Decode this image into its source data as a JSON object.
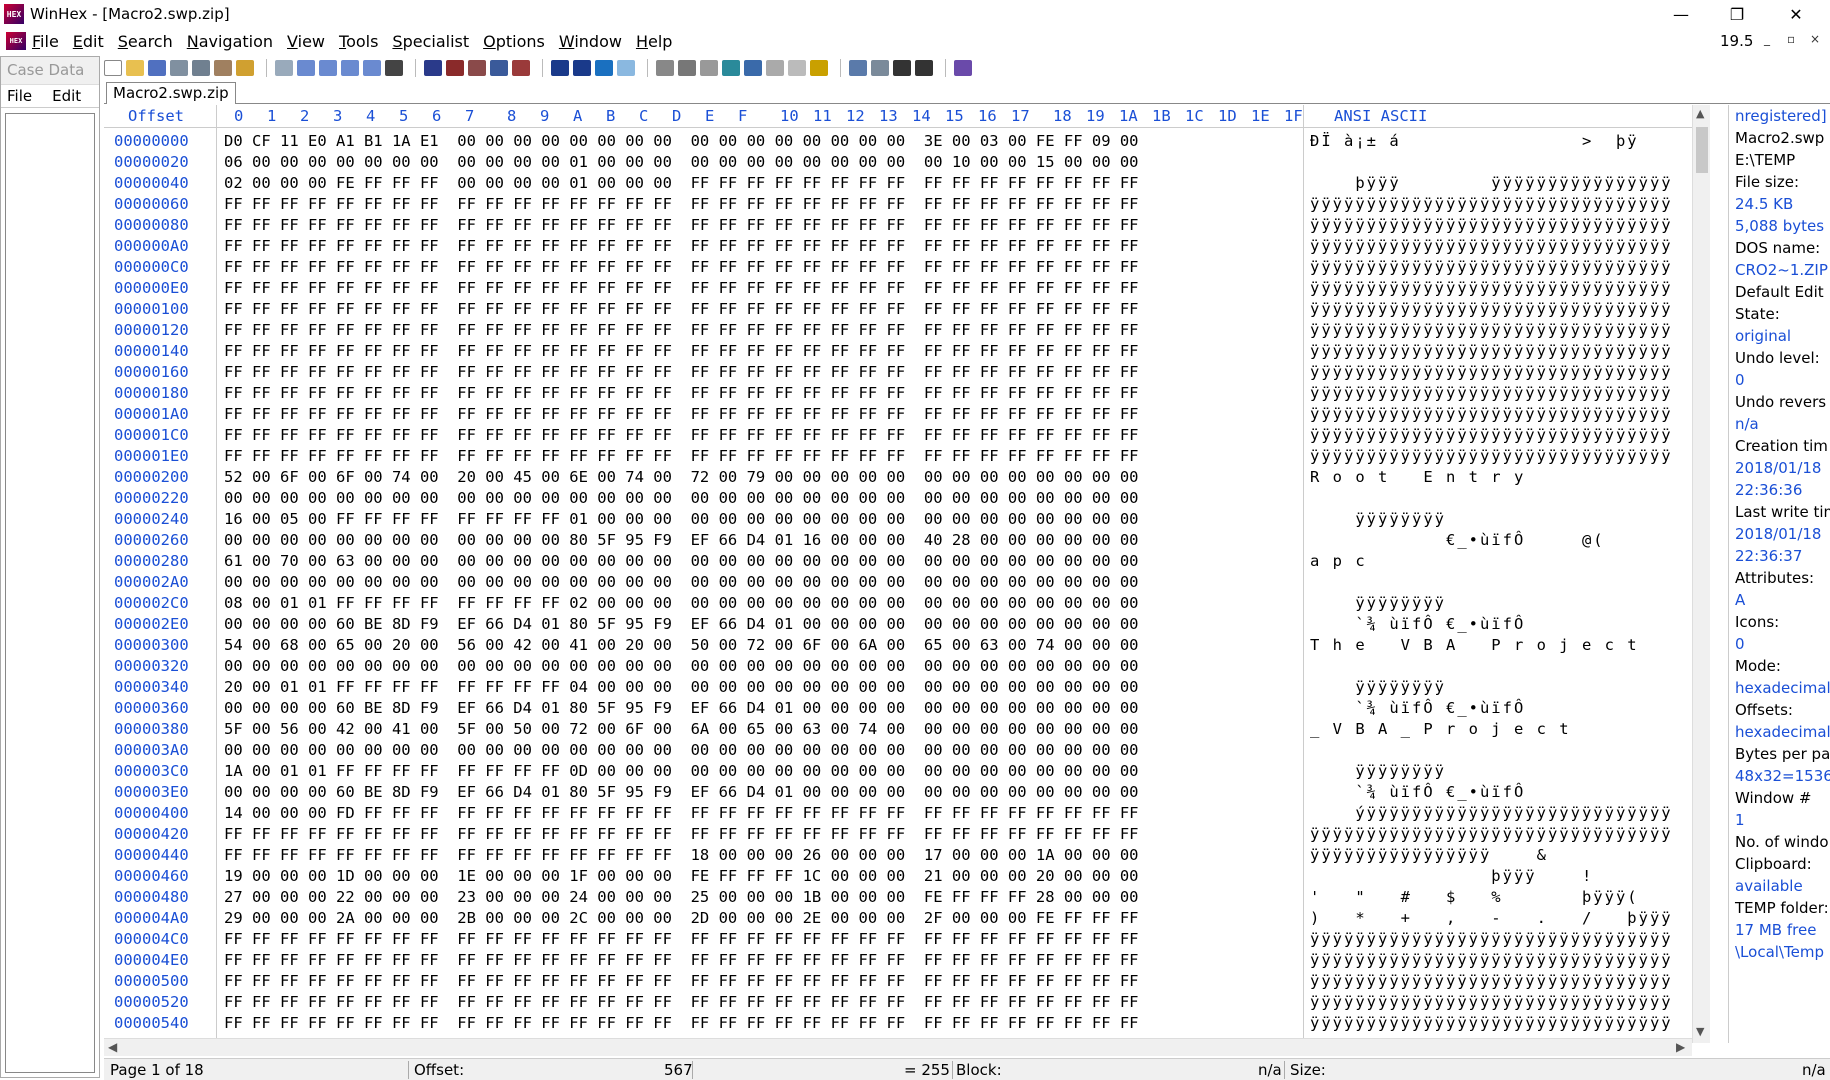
{
  "window": {
    "title": "WinHex - [Macro2.swp.zip]",
    "app_icon": "HEX",
    "min_glyph": "—",
    "max_glyph": "❐",
    "close_glyph": "✕"
  },
  "menu": {
    "items": [
      "File",
      "Edit",
      "Search",
      "Navigation",
      "View",
      "Tools",
      "Specialist",
      "Options",
      "Window",
      "Help"
    ],
    "zoom": "19.5",
    "mdi_min": "_",
    "mdi_restore": "▫",
    "mdi_close": "×"
  },
  "left_pane": {
    "title": "Case Data",
    "menu": [
      "File",
      "Edit"
    ]
  },
  "tab": {
    "label": "Macro2.swp.zip"
  },
  "hex": {
    "offset_header": "Offset",
    "column_headers": [
      "0",
      "1",
      "2",
      "3",
      "4",
      "5",
      "6",
      "7",
      "8",
      "9",
      "A",
      "B",
      "C",
      "D",
      "E",
      "F",
      "10",
      "11",
      "12",
      "13",
      "14",
      "15",
      "16",
      "17",
      "18",
      "19",
      "1A",
      "1B",
      "1C",
      "1D",
      "1E",
      "1F"
    ],
    "text_header": "ANSI ASCII",
    "rows": [
      {
        "offset": "00000000",
        "hex": "D0 CF 11 E0 A1 B1 1A E1  00 00 00 00 00 00 00 00  00 00 00 00 00 00 00 00  3E 00 03 00 FE FF 09 00",
        "ascii": "ÐÏ à¡± á                >  þÿ"
      },
      {
        "offset": "00000020",
        "hex": "06 00 00 00 00 00 00 00  00 00 00 00 01 00 00 00  00 00 00 00 00 00 00 00  00 10 00 00 15 00 00 00",
        "ascii": ""
      },
      {
        "offset": "00000040",
        "hex": "02 00 00 00 FE FF FF FF  00 00 00 00 01 00 00 00  FF FF FF FF FF FF FF FF  FF FF FF FF FF FF FF FF",
        "ascii": "    þÿÿÿ        ÿÿÿÿÿÿÿÿÿÿÿÿÿÿÿÿ"
      },
      {
        "offset": "00000060",
        "hex": "FF FF FF FF FF FF FF FF  FF FF FF FF FF FF FF FF  FF FF FF FF FF FF FF FF  FF FF FF FF FF FF FF FF",
        "ascii": "ÿÿÿÿÿÿÿÿÿÿÿÿÿÿÿÿÿÿÿÿÿÿÿÿÿÿÿÿÿÿÿÿ"
      },
      {
        "offset": "00000080",
        "hex": "FF FF FF FF FF FF FF FF  FF FF FF FF FF FF FF FF  FF FF FF FF FF FF FF FF  FF FF FF FF FF FF FF FF",
        "ascii": "ÿÿÿÿÿÿÿÿÿÿÿÿÿÿÿÿÿÿÿÿÿÿÿÿÿÿÿÿÿÿÿÿ"
      },
      {
        "offset": "000000A0",
        "hex": "FF FF FF FF FF FF FF FF  FF FF FF FF FF FF FF FF  FF FF FF FF FF FF FF FF  FF FF FF FF FF FF FF FF",
        "ascii": "ÿÿÿÿÿÿÿÿÿÿÿÿÿÿÿÿÿÿÿÿÿÿÿÿÿÿÿÿÿÿÿÿ"
      },
      {
        "offset": "000000C0",
        "hex": "FF FF FF FF FF FF FF FF  FF FF FF FF FF FF FF FF  FF FF FF FF FF FF FF FF  FF FF FF FF FF FF FF FF",
        "ascii": "ÿÿÿÿÿÿÿÿÿÿÿÿÿÿÿÿÿÿÿÿÿÿÿÿÿÿÿÿÿÿÿÿ"
      },
      {
        "offset": "000000E0",
        "hex": "FF FF FF FF FF FF FF FF  FF FF FF FF FF FF FF FF  FF FF FF FF FF FF FF FF  FF FF FF FF FF FF FF FF",
        "ascii": "ÿÿÿÿÿÿÿÿÿÿÿÿÿÿÿÿÿÿÿÿÿÿÿÿÿÿÿÿÿÿÿÿ"
      },
      {
        "offset": "00000100",
        "hex": "FF FF FF FF FF FF FF FF  FF FF FF FF FF FF FF FF  FF FF FF FF FF FF FF FF  FF FF FF FF FF FF FF FF",
        "ascii": "ÿÿÿÿÿÿÿÿÿÿÿÿÿÿÿÿÿÿÿÿÿÿÿÿÿÿÿÿÿÿÿÿ"
      },
      {
        "offset": "00000120",
        "hex": "FF FF FF FF FF FF FF FF  FF FF FF FF FF FF FF FF  FF FF FF FF FF FF FF FF  FF FF FF FF FF FF FF FF",
        "ascii": "ÿÿÿÿÿÿÿÿÿÿÿÿÿÿÿÿÿÿÿÿÿÿÿÿÿÿÿÿÿÿÿÿ"
      },
      {
        "offset": "00000140",
        "hex": "FF FF FF FF FF FF FF FF  FF FF FF FF FF FF FF FF  FF FF FF FF FF FF FF FF  FF FF FF FF FF FF FF FF",
        "ascii": "ÿÿÿÿÿÿÿÿÿÿÿÿÿÿÿÿÿÿÿÿÿÿÿÿÿÿÿÿÿÿÿÿ"
      },
      {
        "offset": "00000160",
        "hex": "FF FF FF FF FF FF FF FF  FF FF FF FF FF FF FF FF  FF FF FF FF FF FF FF FF  FF FF FF FF FF FF FF FF",
        "ascii": "ÿÿÿÿÿÿÿÿÿÿÿÿÿÿÿÿÿÿÿÿÿÿÿÿÿÿÿÿÿÿÿÿ"
      },
      {
        "offset": "00000180",
        "hex": "FF FF FF FF FF FF FF FF  FF FF FF FF FF FF FF FF  FF FF FF FF FF FF FF FF  FF FF FF FF FF FF FF FF",
        "ascii": "ÿÿÿÿÿÿÿÿÿÿÿÿÿÿÿÿÿÿÿÿÿÿÿÿÿÿÿÿÿÿÿÿ"
      },
      {
        "offset": "000001A0",
        "hex": "FF FF FF FF FF FF FF FF  FF FF FF FF FF FF FF FF  FF FF FF FF FF FF FF FF  FF FF FF FF FF FF FF FF",
        "ascii": "ÿÿÿÿÿÿÿÿÿÿÿÿÿÿÿÿÿÿÿÿÿÿÿÿÿÿÿÿÿÿÿÿ"
      },
      {
        "offset": "000001C0",
        "hex": "FF FF FF FF FF FF FF FF  FF FF FF FF FF FF FF FF  FF FF FF FF FF FF FF FF  FF FF FF FF FF FF FF FF",
        "ascii": "ÿÿÿÿÿÿÿÿÿÿÿÿÿÿÿÿÿÿÿÿÿÿÿÿÿÿÿÿÿÿÿÿ"
      },
      {
        "offset": "000001E0",
        "hex": "FF FF FF FF FF FF FF FF  FF FF FF FF FF FF FF FF  FF FF FF FF FF FF FF FF  FF FF FF FF FF FF FF FF",
        "ascii": "ÿÿÿÿÿÿÿÿÿÿÿÿÿÿÿÿÿÿÿÿÿÿÿÿÿÿÿÿÿÿÿÿ"
      },
      {
        "offset": "00000200",
        "hex": "52 00 6F 00 6F 00 74 00  20 00 45 00 6E 00 74 00  72 00 79 00 00 00 00 00  00 00 00 00 00 00 00 00",
        "ascii": "R o o t   E n t r y"
      },
      {
        "offset": "00000220",
        "hex": "00 00 00 00 00 00 00 00  00 00 00 00 00 00 00 00  00 00 00 00 00 00 00 00  00 00 00 00 00 00 00 00",
        "ascii": ""
      },
      {
        "offset": "00000240",
        "hex": "16 00 05 00 FF FF FF FF  FF FF FF FF 01 00 00 00  00 00 00 00 00 00 00 00  00 00 00 00 00 00 00 00",
        "ascii": "    ÿÿÿÿÿÿÿÿ"
      },
      {
        "offset": "00000260",
        "hex": "00 00 00 00 00 00 00 00  00 00 00 00 80 5F 95 F9  EF 66 D4 01 16 00 00 00  40 28 00 00 00 00 00 00",
        "ascii": "            €_•ùïfÔ     @("
      },
      {
        "offset": "00000280",
        "hex": "61 00 70 00 63 00 00 00  00 00 00 00 00 00 00 00  00 00 00 00 00 00 00 00  00 00 00 00 00 00 00 00",
        "ascii": "a p c"
      },
      {
        "offset": "000002A0",
        "hex": "00 00 00 00 00 00 00 00  00 00 00 00 00 00 00 00  00 00 00 00 00 00 00 00  00 00 00 00 00 00 00 00",
        "ascii": ""
      },
      {
        "offset": "000002C0",
        "hex": "08 00 01 01 FF FF FF FF  FF FF FF FF 02 00 00 00  00 00 00 00 00 00 00 00  00 00 00 00 00 00 00 00",
        "ascii": "    ÿÿÿÿÿÿÿÿ"
      },
      {
        "offset": "000002E0",
        "hex": "00 00 00 00 60 BE 8D F9  EF 66 D4 01 80 5F 95 F9  EF 66 D4 01 00 00 00 00  00 00 00 00 00 00 00 00",
        "ascii": "    `¾ ùïfÔ €_•ùïfÔ"
      },
      {
        "offset": "00000300",
        "hex": "54 00 68 00 65 00 20 00  56 00 42 00 41 00 20 00  50 00 72 00 6F 00 6A 00  65 00 63 00 74 00 00 00",
        "ascii": "T h e   V B A   P r o j e c t"
      },
      {
        "offset": "00000320",
        "hex": "00 00 00 00 00 00 00 00  00 00 00 00 00 00 00 00  00 00 00 00 00 00 00 00  00 00 00 00 00 00 00 00",
        "ascii": ""
      },
      {
        "offset": "00000340",
        "hex": "20 00 01 01 FF FF FF FF  FF FF FF FF 04 00 00 00  00 00 00 00 00 00 00 00  00 00 00 00 00 00 00 00",
        "ascii": "    ÿÿÿÿÿÿÿÿ"
      },
      {
        "offset": "00000360",
        "hex": "00 00 00 00 60 BE 8D F9  EF 66 D4 01 80 5F 95 F9  EF 66 D4 01 00 00 00 00  00 00 00 00 00 00 00 00",
        "ascii": "    `¾ ùïfÔ €_•ùïfÔ"
      },
      {
        "offset": "00000380",
        "hex": "5F 00 56 00 42 00 41 00  5F 00 50 00 72 00 6F 00  6A 00 65 00 63 00 74 00  00 00 00 00 00 00 00 00",
        "ascii": "_ V B A _ P r o j e c t"
      },
      {
        "offset": "000003A0",
        "hex": "00 00 00 00 00 00 00 00  00 00 00 00 00 00 00 00  00 00 00 00 00 00 00 00  00 00 00 00 00 00 00 00",
        "ascii": ""
      },
      {
        "offset": "000003C0",
        "hex": "1A 00 01 01 FF FF FF FF  FF FF FF FF 0D 00 00 00  00 00 00 00 00 00 00 00  00 00 00 00 00 00 00 00",
        "ascii": "    ÿÿÿÿÿÿÿÿ"
      },
      {
        "offset": "000003E0",
        "hex": "00 00 00 00 60 BE 8D F9  EF 66 D4 01 80 5F 95 F9  EF 66 D4 01 00 00 00 00  00 00 00 00 00 00 00 00",
        "ascii": "    `¾ ùïfÔ €_•ùïfÔ"
      },
      {
        "offset": "00000400",
        "hex": "14 00 00 00 FD FF FF FF  FF FF FF FF FF FF FF FF  FF FF FF FF FF FF FF FF  FF FF FF FF FF FF FF FF",
        "ascii": "    ýÿÿÿÿÿÿÿÿÿÿÿÿÿÿÿÿÿÿÿÿÿÿÿÿÿÿÿ"
      },
      {
        "offset": "00000420",
        "hex": "FF FF FF FF FF FF FF FF  FF FF FF FF FF FF FF FF  FF FF FF FF FF FF FF FF  FF FF FF FF FF FF FF FF",
        "ascii": "ÿÿÿÿÿÿÿÿÿÿÿÿÿÿÿÿÿÿÿÿÿÿÿÿÿÿÿÿÿÿÿÿ"
      },
      {
        "offset": "00000440",
        "hex": "FF FF FF FF FF FF FF FF  FF FF FF FF FF FF FF FF  18 00 00 00 26 00 00 00  17 00 00 00 1A 00 00 00",
        "ascii": "ÿÿÿÿÿÿÿÿÿÿÿÿÿÿÿÿ    &"
      },
      {
        "offset": "00000460",
        "hex": "19 00 00 00 1D 00 00 00  1E 00 00 00 1F 00 00 00  FE FF FF FF 1C 00 00 00  21 00 00 00 20 00 00 00",
        "ascii": "                þÿÿÿ    !"
      },
      {
        "offset": "00000480",
        "hex": "27 00 00 00 22 00 00 00  23 00 00 00 24 00 00 00  25 00 00 00 1B 00 00 00  FE FF FF FF 28 00 00 00",
        "ascii": "'   \"   #   $   %       þÿÿÿ("
      },
      {
        "offset": "000004A0",
        "hex": "29 00 00 00 2A 00 00 00  2B 00 00 00 2C 00 00 00  2D 00 00 00 2E 00 00 00  2F 00 00 00 FE FF FF FF",
        "ascii": ")   *   +   ,   -   .   /   þÿÿÿ"
      },
      {
        "offset": "000004C0",
        "hex": "FF FF FF FF FF FF FF FF  FF FF FF FF FF FF FF FF  FF FF FF FF FF FF FF FF  FF FF FF FF FF FF FF FF",
        "ascii": "ÿÿÿÿÿÿÿÿÿÿÿÿÿÿÿÿÿÿÿÿÿÿÿÿÿÿÿÿÿÿÿÿ"
      },
      {
        "offset": "000004E0",
        "hex": "FF FF FF FF FF FF FF FF  FF FF FF FF FF FF FF FF  FF FF FF FF FF FF FF FF  FF FF FF FF FF FF FF FF",
        "ascii": "ÿÿÿÿÿÿÿÿÿÿÿÿÿÿÿÿÿÿÿÿÿÿÿÿÿÿÿÿÿÿÿÿ"
      },
      {
        "offset": "00000500",
        "hex": "FF FF FF FF FF FF FF FF  FF FF FF FF FF FF FF FF  FF FF FF FF FF FF FF FF  FF FF FF FF FF FF FF FF",
        "ascii": "ÿÿÿÿÿÿÿÿÿÿÿÿÿÿÿÿÿÿÿÿÿÿÿÿÿÿÿÿÿÿÿÿ"
      },
      {
        "offset": "00000520",
        "hex": "FF FF FF FF FF FF FF FF  FF FF FF FF FF FF FF FF  FF FF FF FF FF FF FF FF  FF FF FF FF FF FF FF FF",
        "ascii": "ÿÿÿÿÿÿÿÿÿÿÿÿÿÿÿÿÿÿÿÿÿÿÿÿÿÿÿÿÿÿÿÿ"
      },
      {
        "offset": "00000540",
        "hex": "FF FF FF FF FF FF FF FF  FF FF FF FF FF FF FF FF  FF FF FF FF FF FF FF FF  FF FF FF FF FF FF FF FF",
        "ascii": "ÿÿÿÿÿÿÿÿÿÿÿÿÿÿÿÿÿÿÿÿÿÿÿÿÿÿÿÿÿÿÿÿ"
      }
    ]
  },
  "info_pane": [
    {
      "text": "nregistered]",
      "blue": true
    },
    {
      "text": "Macro2.swp",
      "blue": false
    },
    {
      "text": "E:\\TEMP",
      "blue": false
    },
    {
      "text": "File size:",
      "blue": false
    },
    {
      "text": "24.5 KB",
      "blue": true
    },
    {
      "text": "5,088 bytes",
      "blue": true
    },
    {
      "text": "DOS name:",
      "blue": false
    },
    {
      "text": "CRO2~1.ZIP",
      "blue": true
    },
    {
      "text": "Default Edit",
      "blue": false
    },
    {
      "text": "State:",
      "blue": false
    },
    {
      "text": "original",
      "blue": true
    },
    {
      "text": "Undo level:",
      "blue": false
    },
    {
      "text": "0",
      "blue": true
    },
    {
      "text": "Undo revers",
      "blue": false
    },
    {
      "text": "n/a",
      "blue": true
    },
    {
      "text": "Creation tim",
      "blue": false
    },
    {
      "text": "2018/01/18",
      "blue": true
    },
    {
      "text": "22:36:36",
      "blue": true
    },
    {
      "text": "Last write tim",
      "blue": false
    },
    {
      "text": "2018/01/18",
      "blue": true
    },
    {
      "text": "22:36:37",
      "blue": true
    },
    {
      "text": "Attributes:",
      "blue": false
    },
    {
      "text": "A",
      "blue": true
    },
    {
      "text": "Icons:",
      "blue": false
    },
    {
      "text": "0",
      "blue": true
    },
    {
      "text": "Mode:",
      "blue": false
    },
    {
      "text": "hexadecimal",
      "blue": true
    },
    {
      "text": "Offsets:",
      "blue": false
    },
    {
      "text": "hexadecimal",
      "blue": true
    },
    {
      "text": "Bytes per pa",
      "blue": false
    },
    {
      "text": "48x32=1536",
      "blue": true
    },
    {
      "text": "Window #",
      "blue": false
    },
    {
      "text": "1",
      "blue": true
    },
    {
      "text": "No. of windo",
      "blue": false
    },
    {
      "text": "Clipboard:",
      "blue": false
    },
    {
      "text": "available",
      "blue": true
    },
    {
      "text": "TEMP folder:",
      "blue": false
    },
    {
      "text": "17 MB free",
      "blue": true
    },
    {
      "text": "\\Local\\Temp",
      "blue": true
    }
  ],
  "status": {
    "page": "Page 1 of 18",
    "offset_label": "Offset:",
    "offset_value": "567",
    "eq": "= 255",
    "block_label": "Block:",
    "block_value": "n/a",
    "size_label": "Size:",
    "size_value": "n/a"
  },
  "colors": {
    "offset_blue": "#1a4fd6"
  }
}
